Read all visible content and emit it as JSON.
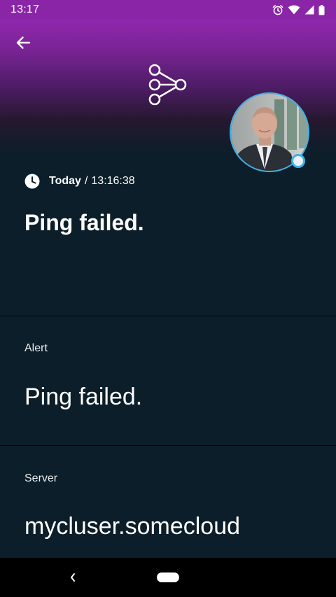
{
  "status_bar": {
    "time": "13:17",
    "icons": [
      "alarm-icon",
      "wifi-icon",
      "signal-icon",
      "battery-icon"
    ]
  },
  "header": {
    "back_icon": "arrow-left-icon",
    "logo_icon": "share-network-icon",
    "avatar_status": "online"
  },
  "notification": {
    "day": "Today",
    "separator": "/",
    "time": "13:16:38",
    "headline": "Ping failed."
  },
  "fields": [
    {
      "label": "Alert",
      "value": "Ping failed."
    },
    {
      "label": "Server",
      "value": "mycluser.somecloud"
    }
  ],
  "colors": {
    "accent": "#3fb2e6",
    "header_top": "#9027ad",
    "background": "#0c1e29"
  }
}
